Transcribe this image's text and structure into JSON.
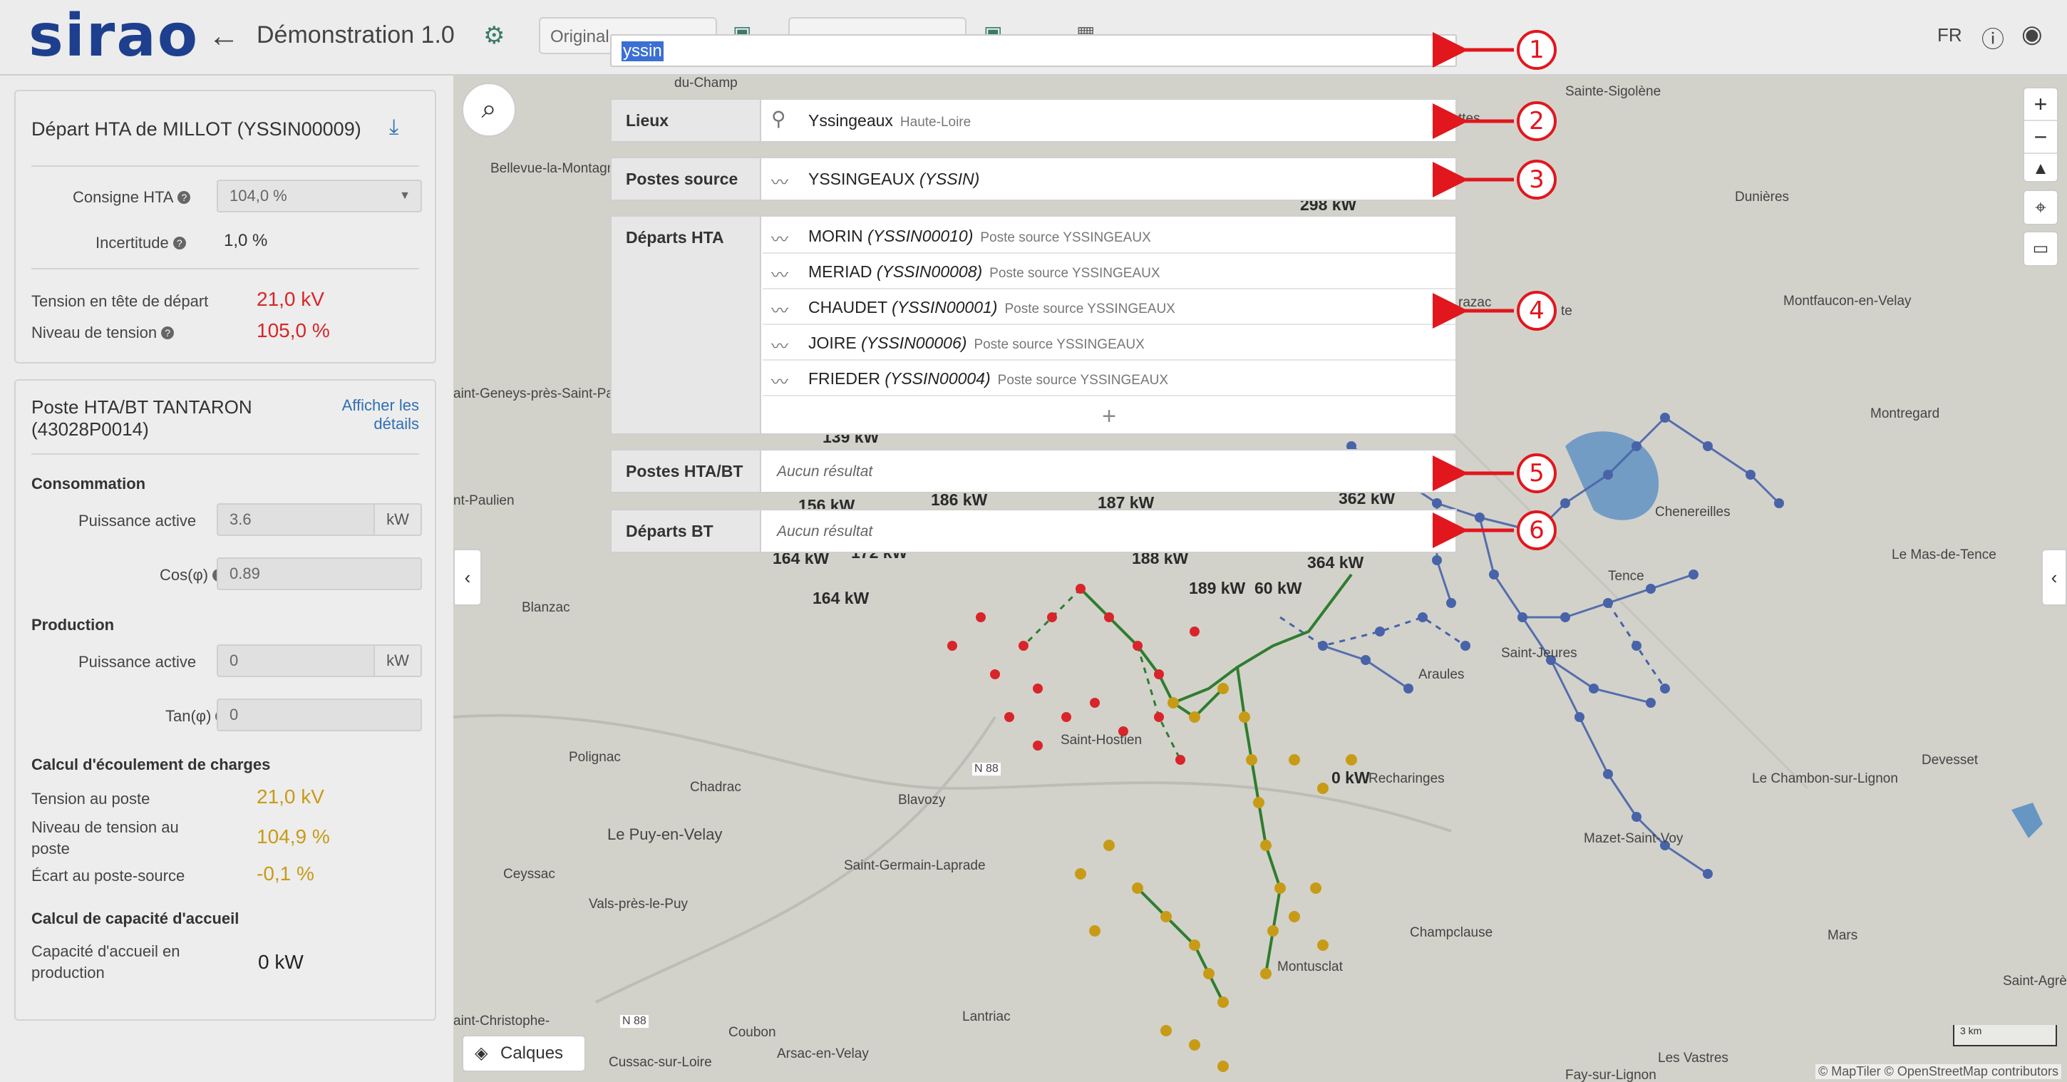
{
  "header": {
    "logo": "sirao",
    "title": "Démonstration 1.0",
    "original_select": "Original",
    "lang": "FR"
  },
  "search": {
    "value": "yssin"
  },
  "results": {
    "lieux": {
      "label": "Lieux",
      "items": [
        {
          "name": "Yssingeaux",
          "sub": "Haute-Loire"
        }
      ]
    },
    "postes_source": {
      "label": "Postes source",
      "items": [
        {
          "name": "YSSINGEAUX",
          "code": "(YSSIN)"
        }
      ]
    },
    "departs_hta": {
      "label": "Départs HTA",
      "items": [
        {
          "name": "MORIN",
          "code": "(YSSIN00010)",
          "sub": "Poste source YSSINGEAUX"
        },
        {
          "name": "MERIAD",
          "code": "(YSSIN00008)",
          "sub": "Poste source YSSINGEAUX"
        },
        {
          "name": "CHAUDET",
          "code": "(YSSIN00001)",
          "sub": "Poste source YSSINGEAUX"
        },
        {
          "name": "JOIRE",
          "code": "(YSSIN00006)",
          "sub": "Poste source YSSINGEAUX"
        },
        {
          "name": "FRIEDER",
          "code": "(YSSIN00004)",
          "sub": "Poste source YSSINGEAUX"
        }
      ],
      "more": "+"
    },
    "postes_hta_bt": {
      "label": "Postes HTA/BT",
      "empty": "Aucun résultat"
    },
    "departs_bt": {
      "label": "Départs BT",
      "empty": "Aucun résultat"
    }
  },
  "callouts": [
    "1",
    "2",
    "3",
    "4",
    "5",
    "6"
  ],
  "sidebar": {
    "depart": {
      "title": "Départ HTA de MILLOT (YSSIN00009)",
      "consigne_label": "Consigne HTA",
      "consigne_value": "104,0 %",
      "incertitude_label": "Incertitude",
      "incertitude_value": "1,0 %",
      "tension_label": "Tension en tête de départ",
      "tension_value": "21,0 kV",
      "niveau_label": "Niveau de tension",
      "niveau_value": "105,0 %"
    },
    "poste": {
      "title_line1": "Poste HTA/BT TANTARON",
      "title_line2": "(43028P0014)",
      "link_line1": "Afficher les",
      "link_line2": "détails",
      "consommation": "Consommation",
      "puissance_active_label": "Puissance active",
      "puissance_active_value": "3.6",
      "unit_kw": "kW",
      "cos_label": "Cos(φ)",
      "cos_value": "0.89",
      "production": "Production",
      "prod_puissance_label": "Puissance active",
      "prod_puissance_value": "0",
      "tan_label": "Tan(φ)",
      "tan_value": "0",
      "calcul_ecoulement": "Calcul d'écoulement de charges",
      "tension_poste_label": "Tension au poste",
      "tension_poste_value": "21,0 kV",
      "niveau_poste_label_1": "Niveau de tension au",
      "niveau_poste_label_2": "poste",
      "niveau_poste_value": "104,9 %",
      "ecart_label": "Écart au poste-source",
      "ecart_value": "-0,1 %",
      "calcul_capacite": "Calcul de capacité d'accueil",
      "capacite_label_1": "Capacité d'accueil en",
      "capacite_label_2": "production",
      "capacite_value": "0 kW"
    }
  },
  "map": {
    "places": [
      "du-Champ",
      "Sainte-Sigolène",
      "Bellevue-la-Montagne",
      "Dunières",
      "Montfaucon-en-Velay",
      "Montregard",
      "aint-Geneys-près-Saint-Paulien",
      "nt-Paulien",
      "Blanzac",
      "Le Mas-de-Tence",
      "Tence",
      "Saint-Jeures",
      "Araules",
      "Saint-Hostien",
      "Polignac",
      "Chadrac",
      "Blavozy",
      "Le Puy-en-Velay",
      "Recharinges",
      "Le Chambon-sur-Lignon",
      "Devesset",
      "Mazet-Saint-Voy",
      "Ceyssac",
      "Vals-près-le-Puy",
      "Saint-Germain-Laprade",
      "Champclause",
      "Montusclat",
      "Mars",
      "Saint-Agrè",
      "Lantriac",
      "Coubon",
      "Arsac-en-Velay",
      "Cussac-sur-Loire",
      "Les Vastres",
      "Fay-sur-Lignon",
      "aint-Christophe-",
      "N 88",
      "N 88",
      "Chenereilles",
      "razac",
      "te",
      "ttes"
    ],
    "kw_labels": [
      "298 kW",
      "186 kW",
      "187 kW",
      "156 kW",
      "139 kW",
      "164 kW",
      "164 kW",
      "172 kW",
      "188 kW",
      "189 kW",
      "60 kW",
      "364 kW",
      "362 kW",
      "0 kW"
    ],
    "layers_label": "Calques",
    "scale": "3 km",
    "attribution": "© MapTiler © OpenStreetMap contributors"
  }
}
